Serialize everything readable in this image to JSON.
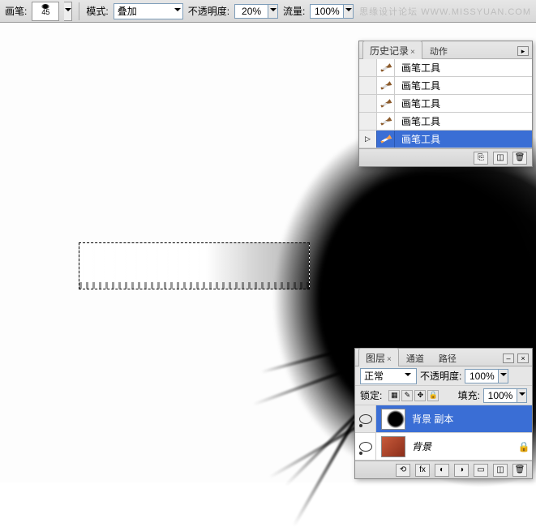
{
  "toolbar": {
    "brush_label": "画笔:",
    "brush_size": "45",
    "mode_label": "模式:",
    "mode_value": "叠加",
    "opacity_label": "不透明度:",
    "opacity_value": "20%",
    "flow_label": "流量:",
    "flow_value": "100%"
  },
  "watermark": "思缘设计论坛   WWW.MISSYUAN.COM",
  "history_panel": {
    "tab_history": "历史记录",
    "tab_actions": "动作",
    "items": [
      {
        "label": "画笔工具"
      },
      {
        "label": "画笔工具"
      },
      {
        "label": "画笔工具"
      },
      {
        "label": "画笔工具"
      },
      {
        "label": "画笔工具"
      }
    ]
  },
  "layers_panel": {
    "tab_layers": "图层",
    "tab_channels": "通道",
    "tab_paths": "路径",
    "blend_mode": "正常",
    "opacity_label": "不透明度:",
    "opacity_value": "100%",
    "lock_label": "锁定:",
    "fill_label": "填充:",
    "fill_value": "100%",
    "layers": [
      {
        "name": "背景 副本"
      },
      {
        "name": "背景"
      }
    ]
  }
}
